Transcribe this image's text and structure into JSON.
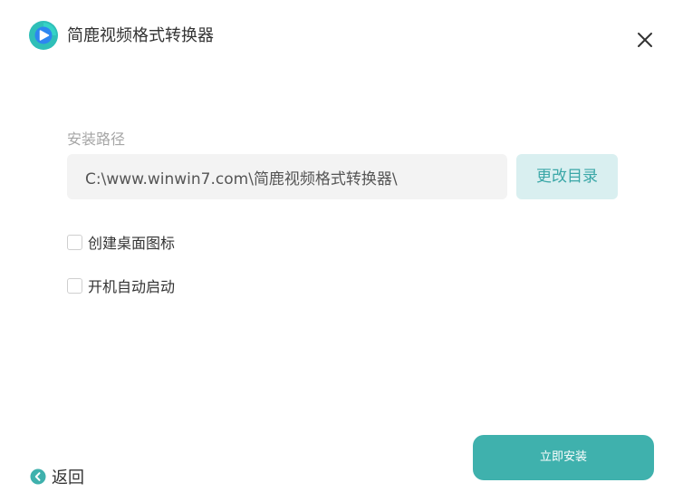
{
  "app": {
    "title": "简鹿视频格式转换器"
  },
  "install": {
    "path_label": "安装路径",
    "path_value": "C:\\www.winwin7.com\\简鹿视频格式转换器\\",
    "change_dir_label": "更改目录",
    "options": [
      {
        "label": "创建桌面图标",
        "checked": false
      },
      {
        "label": "开机自动启动",
        "checked": false
      }
    ],
    "install_button_label": "立即安装",
    "back_label": "返回"
  },
  "colors": {
    "accent": "#3fb1ad",
    "accent_light": "#d9eff0",
    "logo_outer": "#2fbfb8",
    "logo_inner": "#2d86f0"
  },
  "icons": {
    "logo": "app-logo-icon",
    "close": "close-icon",
    "back": "back-arrow-icon"
  }
}
